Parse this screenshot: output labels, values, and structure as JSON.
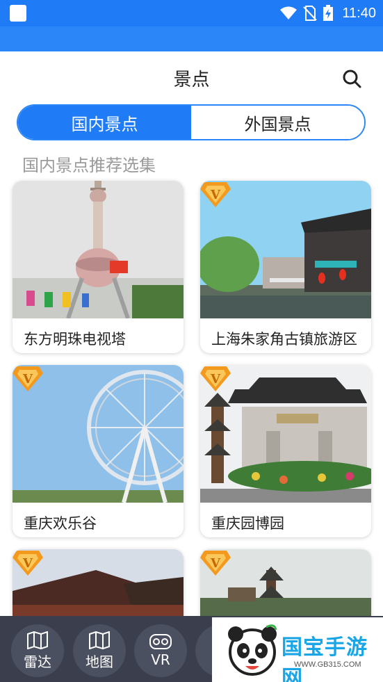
{
  "statusbar": {
    "time": "11:40"
  },
  "header": {
    "title": "景点"
  },
  "tabs": [
    {
      "label": "国内景点",
      "active": true
    },
    {
      "label": "外国景点",
      "active": false
    }
  ],
  "section": {
    "title": "国内景点推荐选集"
  },
  "cards": [
    {
      "name": "东方明珠电视塔",
      "vip": false
    },
    {
      "name": "上海朱家角古镇旅游区",
      "vip": true
    },
    {
      "name": "重庆欢乐谷",
      "vip": true
    },
    {
      "name": "重庆园博园",
      "vip": true
    },
    {
      "name": "",
      "vip": true
    },
    {
      "name": "",
      "vip": true
    }
  ],
  "bottom_nav": [
    {
      "label": "雷达",
      "icon": "map-icon"
    },
    {
      "label": "地图",
      "icon": "map-icon"
    },
    {
      "label": "VR",
      "icon": "vr-goggles-icon"
    }
  ],
  "badge_letter": "V",
  "watermark": {
    "brand": "国宝手游网",
    "url": "WWW.GB315.COM"
  },
  "colors": {
    "primary": "#1f7cf6",
    "bottom_bar": "#3b3f4d",
    "badge": "#f39a1e"
  }
}
